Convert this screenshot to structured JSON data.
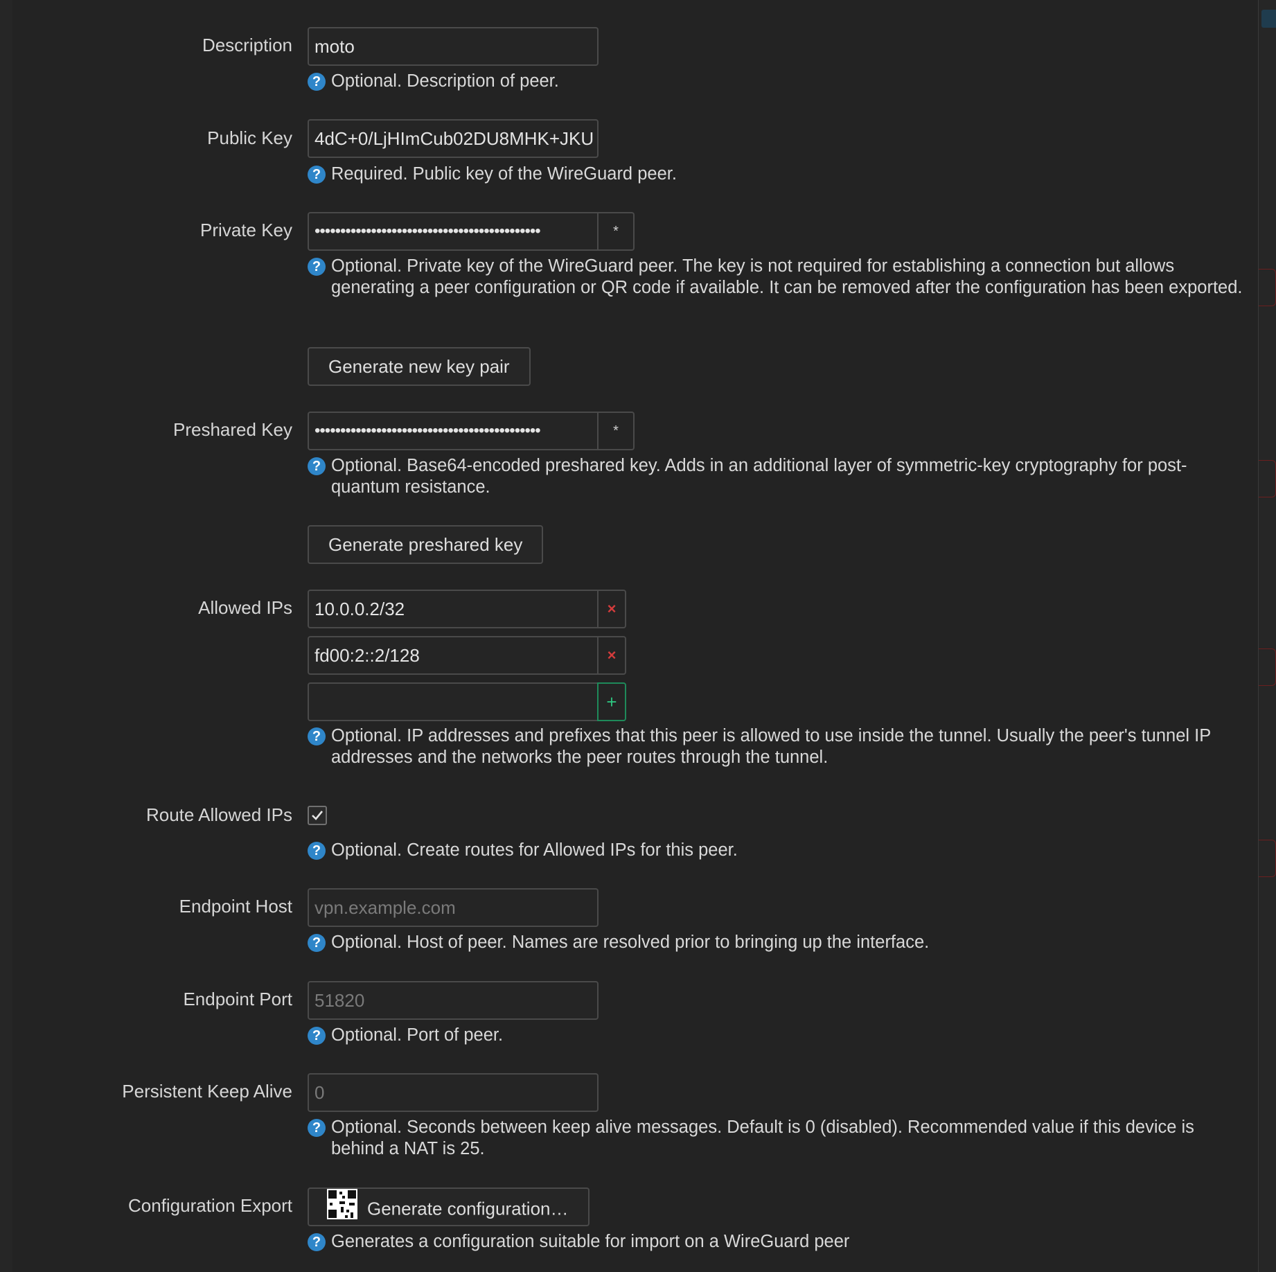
{
  "fields": {
    "description": {
      "label": "Description",
      "value": "moto",
      "help": "Optional. Description of peer."
    },
    "public_key": {
      "label": "Public Key",
      "value": "4dC+0/LjHImCub02DU8MHK+JKU",
      "help": "Required. Public key of the WireGuard peer."
    },
    "private_key": {
      "label": "Private Key",
      "value": "••••••••••••••••••••••••••••••••••••••••••••",
      "toggle": "*",
      "help": "Optional. Private key of the WireGuard peer. The key is not required for establishing a connection but allows generating a peer configuration or QR code if available. It can be removed after the configuration has been exported.",
      "button": "Generate new key pair"
    },
    "preshared_key": {
      "label": "Preshared Key",
      "value": "••••••••••••••••••••••••••••••••••••••••••••",
      "toggle": "*",
      "help": "Optional. Base64-encoded preshared key. Adds in an additional layer of symmetric-key cryptography for post-quantum resistance.",
      "button": "Generate preshared key"
    },
    "allowed_ips": {
      "label": "Allowed IPs",
      "items": [
        "10.0.0.2/32",
        "fd00:2::2/128"
      ],
      "remove_icon": "×",
      "add_icon": "+",
      "new_value": "",
      "help": "Optional. IP addresses and prefixes that this peer is allowed to use inside the tunnel. Usually the peer's tunnel IP addresses and the networks the peer routes through the tunnel."
    },
    "route_allowed_ips": {
      "label": "Route Allowed IPs",
      "checked": true,
      "help": "Optional. Create routes for Allowed IPs for this peer."
    },
    "endpoint_host": {
      "label": "Endpoint Host",
      "placeholder": "vpn.example.com",
      "help": "Optional. Host of peer. Names are resolved prior to bringing up the interface."
    },
    "endpoint_port": {
      "label": "Endpoint Port",
      "placeholder": "51820",
      "help": "Optional. Port of peer."
    },
    "persistent_keepalive": {
      "label": "Persistent Keep Alive",
      "placeholder": "0",
      "help": "Optional. Seconds between keep alive messages. Default is 0 (disabled). Recommended value if this device is behind a NAT is 25."
    },
    "config_export": {
      "label": "Configuration Export",
      "button": "Generate configuration…",
      "help": "Generates a configuration suitable for import on a WireGuard peer"
    }
  },
  "help_icon": "?",
  "colors": {
    "help_icon": "#2f86c9",
    "remove": "#d43c3c",
    "add": "#2ec27e",
    "background": "#232323"
  }
}
